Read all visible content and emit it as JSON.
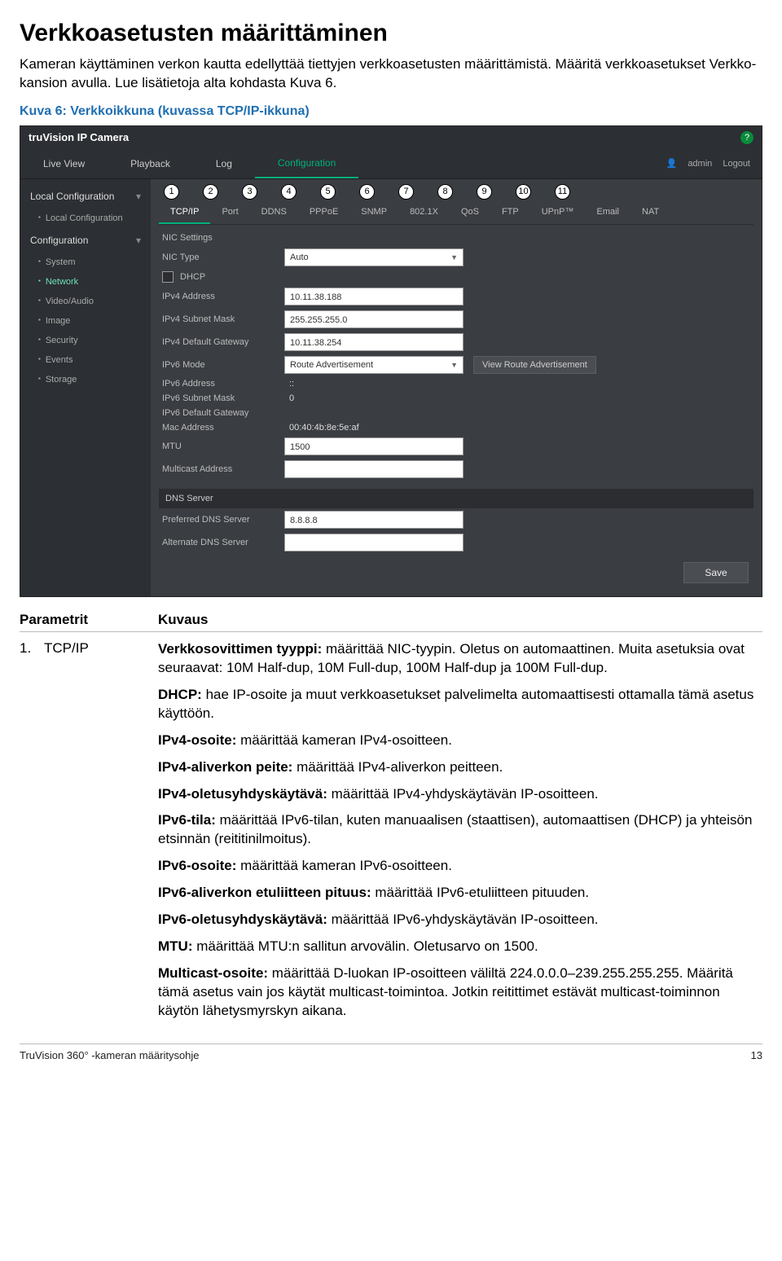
{
  "page": {
    "title": "Verkkoasetusten määrittäminen",
    "intro1": "Kameran käyttäminen verkon kautta edellyttää tiettyjen verkkoasetusten määrittämistä. Määritä verkkoasetukset Verkko-kansion avulla. Lue lisätietoja alta kohdasta Kuva 6.",
    "caption": "Kuva 6: Verkkoikkuna (kuvassa TCP/IP-ikkuna)"
  },
  "ui": {
    "brand": "truVision IP Camera",
    "mainTabs": [
      "Live View",
      "Playback",
      "Log",
      "Configuration"
    ],
    "mainActive": 3,
    "user": "admin",
    "logout": "Logout",
    "side": {
      "localGroup": "Local Configuration",
      "localItems": [
        "Local Configuration"
      ],
      "confGroup": "Configuration",
      "confItems": [
        "System",
        "Network",
        "Video/Audio",
        "Image",
        "Security",
        "Events",
        "Storage"
      ],
      "confActive": 1
    },
    "subTabs": [
      "TCP/IP",
      "Port",
      "DDNS",
      "PPPoE",
      "SNMP",
      "802.1X",
      "QoS",
      "FTP",
      "UPnP™",
      "Email",
      "NAT"
    ],
    "subActive": 0,
    "nic": {
      "section": "NIC Settings",
      "type_label": "NIC Type",
      "type_value": "Auto",
      "dhcp_label": "DHCP",
      "ipv4a_label": "IPv4 Address",
      "ipv4a": "10.11.38.188",
      "ipv4m_label": "IPv4 Subnet Mask",
      "ipv4m": "255.255.255.0",
      "ipv4g_label": "IPv4 Default Gateway",
      "ipv4g": "10.11.38.254",
      "ipv6m_label": "IPv6 Mode",
      "ipv6m": "Route Advertisement",
      "ipv6m_btn": "View Route Advertisement",
      "ipv6a_label": "IPv6 Address",
      "ipv6a": "::",
      "ipv6s_label": "IPv6 Subnet Mask",
      "ipv6s": "0",
      "ipv6g_label": "IPv6 Default Gateway",
      "ipv6g": "",
      "mac_label": "Mac Address",
      "mac": "00:40:4b:8e:5e:af",
      "mtu_label": "MTU",
      "mtu": "1500",
      "mca_label": "Multicast Address",
      "mca": ""
    },
    "dns": {
      "section": "DNS Server",
      "pref_label": "Preferred DNS Server",
      "pref": "8.8.8.8",
      "alt_label": "Alternate DNS Server",
      "alt": ""
    },
    "save": "Save"
  },
  "circles": [
    "1",
    "2",
    "3",
    "4",
    "5",
    "6",
    "7",
    "8",
    "9",
    "10",
    "11"
  ],
  "params": {
    "head1": "Parametrit",
    "head2": "Kuvaus",
    "num": "1.",
    "name": "TCP/IP",
    "d1a": "Verkkosovittimen tyyppi:",
    "d1b": " määrittää NIC-tyypin. Oletus on automaattinen. Muita asetuksia ovat seuraavat: 10M Half-dup, 10M Full-dup, 100M Half-dup ja 100M Full-dup.",
    "d2a": "DHCP:",
    "d2b": " hae IP-osoite ja muut verkkoasetukset palvelimelta automaattisesti ottamalla tämä asetus käyttöön.",
    "d3a": "IPv4-osoite:",
    "d3b": " määrittää kameran IPv4-osoitteen.",
    "d4a": "IPv4-aliverkon peite:",
    "d4b": " määrittää IPv4-aliverkon peitteen.",
    "d5a": "IPv4-oletusyhdyskäytävä:",
    "d5b": " määrittää IPv4-yhdyskäytävän IP-osoitteen.",
    "d6a": "IPv6-tila:",
    "d6b": " määrittää IPv6-tilan, kuten manuaalisen (staattisen), automaattisen (DHCP) ja yhteisön etsinnän (reititinilmoitus).",
    "d7a": "IPv6-osoite:",
    "d7b": " määrittää kameran IPv6-osoitteen.",
    "d8a": "IPv6-aliverkon etuliitteen pituus:",
    "d8b": " määrittää IPv6-etuliitteen pituuden.",
    "d9a": "IPv6-oletusyhdyskäytävä:",
    "d9b": " määrittää IPv6-yhdyskäytävän IP-osoitteen.",
    "d10a": "MTU:",
    "d10b": " määrittää MTU:n sallitun arvovälin. Oletusarvo on 1500.",
    "d11a": "Multicast-osoite:",
    "d11b": " määrittää D-luokan IP-osoitteen väliltä 224.0.0.0–239.255.255.255. Määritä tämä asetus vain jos käytät multicast-toimintoa. Jotkin reitittimet estävät multicast-toiminnon käytön lähetysmyrskyn aikana."
  },
  "footer": {
    "left": "TruVision 360° -kameran määritysohje",
    "right": "13"
  }
}
